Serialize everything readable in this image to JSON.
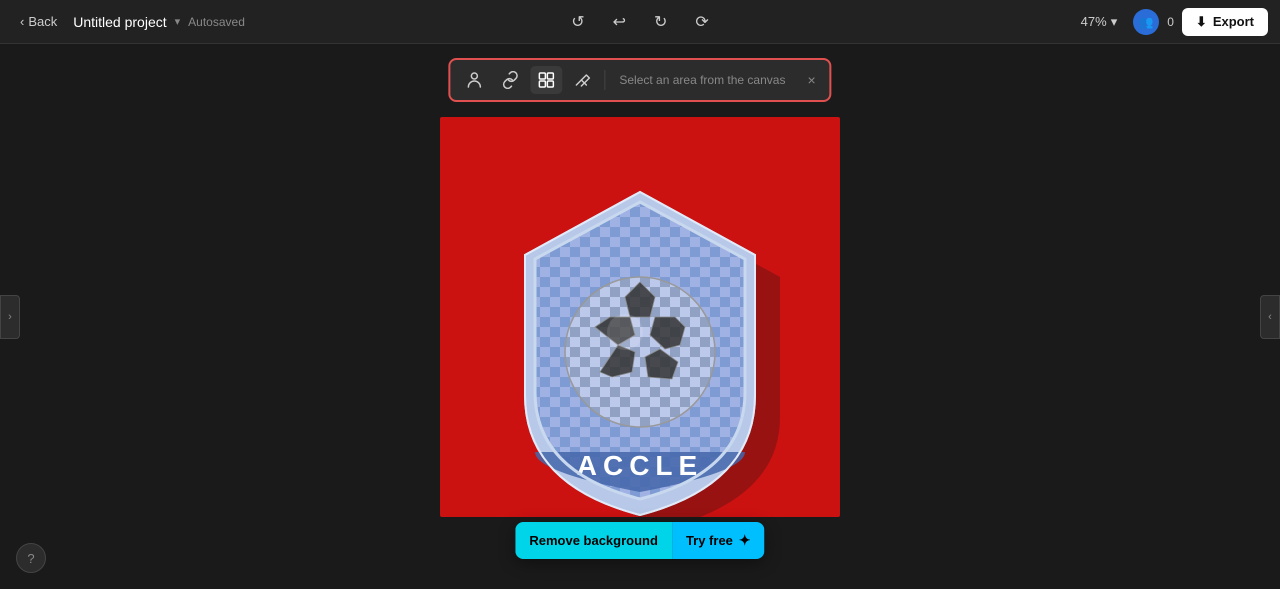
{
  "header": {
    "back_label": "Back",
    "project_name": "Untitled project",
    "autosaved_label": "Autosaved",
    "zoom_level": "47%",
    "collab_count": "0",
    "export_label": "Export"
  },
  "toolbar": {
    "hint": "Select an area from the canvas",
    "icons": [
      {
        "name": "person-icon",
        "symbol": "👤",
        "label": "Person select"
      },
      {
        "name": "link-icon",
        "symbol": "🔗",
        "label": "Link"
      },
      {
        "name": "select-icon",
        "symbol": "⊹",
        "label": "Select area",
        "active": true
      },
      {
        "name": "eraser-icon",
        "symbol": "◻",
        "label": "Eraser"
      }
    ],
    "close_label": "×"
  },
  "remove_bg": {
    "remove_label": "Remove background",
    "try_free_label": "Try free"
  },
  "sidebar": {
    "left_arrow": "‹",
    "right_arrow": "›"
  },
  "help": {
    "label": "?"
  }
}
